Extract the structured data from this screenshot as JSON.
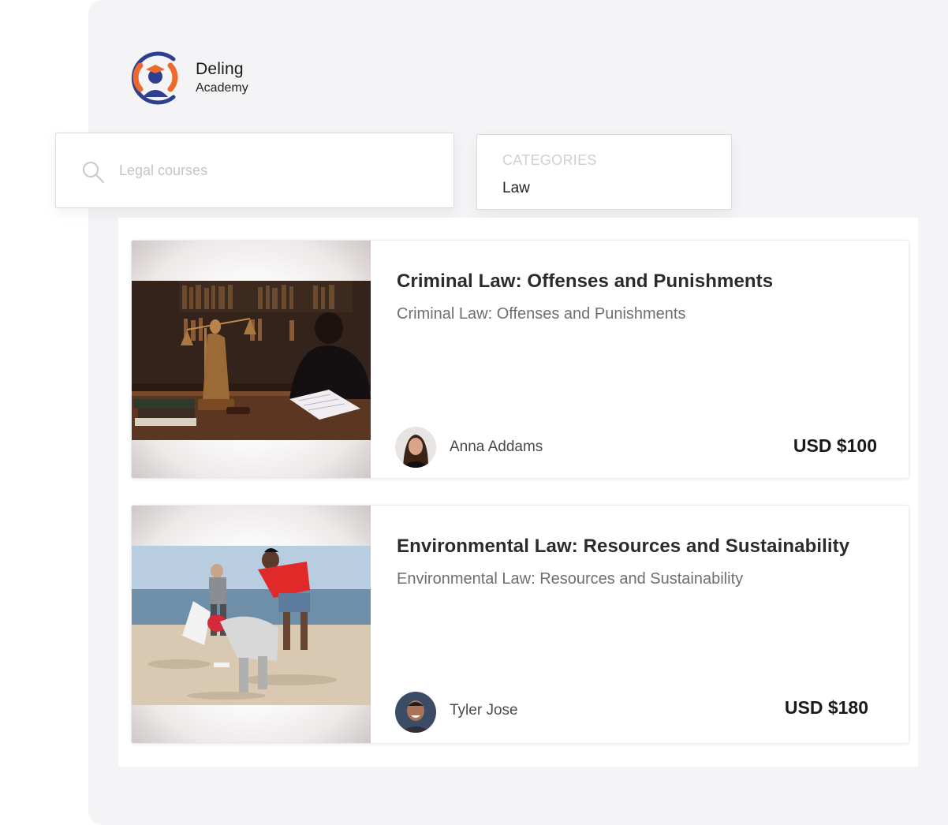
{
  "brand": {
    "name": "Deling",
    "subtitle": "Academy",
    "colors": {
      "ring": "#2e3f8f",
      "accent": "#ee6a2c"
    }
  },
  "search": {
    "placeholder": "Legal courses",
    "value": "",
    "icon": "search-icon"
  },
  "category_filter": {
    "label": "CATEGORIES",
    "value": "Law"
  },
  "courses": [
    {
      "title": "Criminal Law: Offenses and Punishments",
      "subtitle": "Criminal Law: Offenses and Punishments",
      "instructor": "Anna Addams",
      "price": "USD $100",
      "image": "lady-justice-statue-and-judge-writing"
    },
    {
      "title": "Environmental Law: Resources and Sustainability",
      "subtitle": "Environmental Law: Resources and Sustainability",
      "instructor": "Tyler Jose",
      "price": "USD $180",
      "image": "volunteers-cleaning-beach"
    }
  ]
}
